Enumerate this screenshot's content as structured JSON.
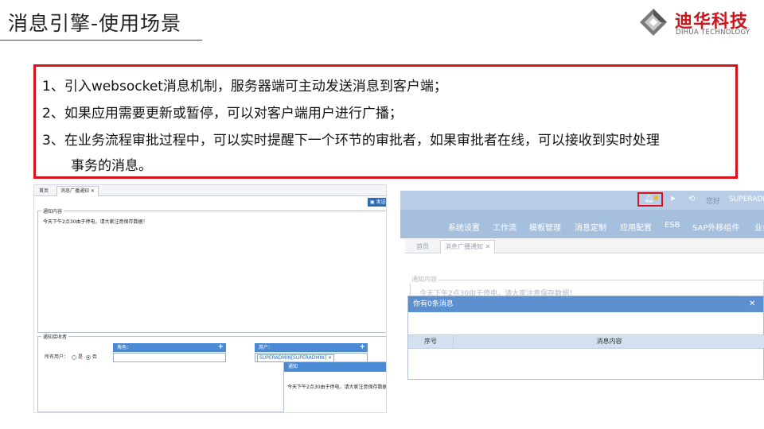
{
  "slide": {
    "title": "消息引擎-使用场景",
    "logo_cn": "迪华科技",
    "logo_en": "DIHUA TECHNOLOGY",
    "points": [
      "1、引入websocket消息机制，服务器端可主动发送消息到客户端；",
      "2、如果应用需要更新或暂停，可以对客户端用户进行广播；",
      "3、在业务流程审批过程中，可以实时提醒下一个环节的审批者，如果审批者在线，可以接收到实时处理",
      "事务的消息。"
    ]
  },
  "left_shot": {
    "tab_home": "首页",
    "tab_notice": "消息广播通知 ✕",
    "send_button": "发送",
    "content_legend": "通知内容",
    "content_text": "今天下午2点30由于停电，请大家注意保存数据！",
    "receivers_legend": "通知接收者",
    "all_users_label": "所有用户：",
    "radio_yes": "是",
    "radio_no": "否",
    "role_label": "角色：",
    "user_label": "用户：",
    "user_tag": "SUPERADMIN[SUPERADMIN] ✕",
    "popup_title": "通知",
    "popup_text": "今天下午2点30由于停电，请大家注意保存数据！"
  },
  "right_shot": {
    "hello": "您好",
    "user": "SUPERADMIN",
    "nav": [
      "系统设置",
      "工作流",
      "模板管理",
      "消息定制",
      "应用配置",
      "ESB",
      "SAP外移组件",
      "业务"
    ],
    "tab_home": "首页",
    "tab_notice": "消息广播通知 ✕",
    "content_legend": "通知内容",
    "content_text": "今天下午2点30由于停电，请大家注意保存数据！",
    "dialog_title": "你有0条消息",
    "col_index": "序号",
    "col_content": "消息内容"
  },
  "colors": {
    "accent_red": "#d9121b",
    "brand_red": "#c8161d",
    "header_blue": "#5b8fcf"
  },
  "icons": [
    "bell-icon",
    "send-icon",
    "refresh-icon",
    "close-icon",
    "plus-icon"
  ]
}
